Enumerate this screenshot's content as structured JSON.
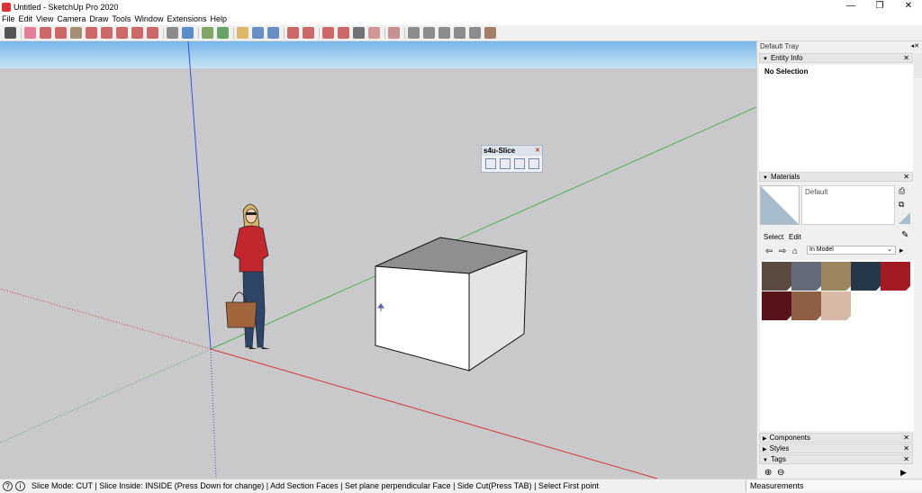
{
  "window": {
    "title": "Untitled - SketchUp Pro 2020",
    "controls": [
      "—",
      "❐",
      "✕"
    ]
  },
  "menu": [
    "File",
    "Edit",
    "View",
    "Camera",
    "Draw",
    "Tools",
    "Window",
    "Extensions",
    "Help"
  ],
  "toolbar": {
    "tools": [
      {
        "icon": "select-icon",
        "color": "#222222"
      },
      {
        "icon": "eraser-icon",
        "color": "#e05a7a"
      },
      {
        "icon": "line-icon",
        "color": "#c23b3b"
      },
      {
        "icon": "arc-icon",
        "color": "#c23b3b"
      },
      {
        "icon": "shape-icon",
        "color": "#8d6d4a"
      },
      {
        "icon": "push-pull-icon",
        "color": "#c23b3b"
      },
      {
        "icon": "offset-icon",
        "color": "#c23b3b"
      },
      {
        "icon": "move-icon",
        "color": "#c23b3b"
      },
      {
        "icon": "rotate-icon",
        "color": "#c23b3b"
      },
      {
        "icon": "scale-icon",
        "color": "#c23b3b"
      },
      {
        "icon": "tape-measure-icon",
        "color": "#6a6a6a"
      },
      {
        "icon": "text-icon",
        "color": "#2a6ebb"
      },
      {
        "icon": "paint-bucket-icon",
        "color": "#5a8c3a"
      },
      {
        "icon": "orbit-icon",
        "color": "#3a8a3a"
      },
      {
        "icon": "pan-icon",
        "color": "#d6a33c"
      },
      {
        "icon": "zoom-icon",
        "color": "#3a6fb5"
      },
      {
        "icon": "zoom-extents-icon",
        "color": "#3a6fb5"
      },
      {
        "icon": "warehouse-icon",
        "color": "#c23b3b"
      },
      {
        "icon": "extension-warehouse-icon",
        "color": "#c23b3b"
      },
      {
        "icon": "layout-icon",
        "color": "#c23b3b"
      },
      {
        "icon": "ruby-icon",
        "color": "#c23b3b"
      },
      {
        "icon": "account-icon",
        "color": "#4a4a4a"
      },
      {
        "icon": "section-plane-icon",
        "color": "#c77a7a"
      },
      {
        "icon": "style-icon-1",
        "color": "#b57070"
      },
      {
        "icon": "style-icon-2",
        "color": "#6b6b6b"
      },
      {
        "icon": "style-icon-3",
        "color": "#6b6b6b"
      },
      {
        "icon": "style-icon-4",
        "color": "#6b6b6b"
      },
      {
        "icon": "style-icon-5",
        "color": "#6b6b6b"
      },
      {
        "icon": "style-icon-6",
        "color": "#6b6b6b"
      },
      {
        "icon": "style-icon-7",
        "color": "#8a5a3a"
      }
    ]
  },
  "slice_toolbar": {
    "title": "s4u-Slice",
    "buttons": [
      "slice-mode-icon",
      "slice-inside-icon",
      "slice-section-icon",
      "slice-cut-icon"
    ]
  },
  "tray": {
    "title": "Default Tray",
    "entity_info": {
      "header": "Entity Info",
      "selection": "No Selection"
    },
    "materials": {
      "header": "Materials",
      "material_name": "Default",
      "tabs": [
        "Select",
        "Edit"
      ],
      "collection": "In Model",
      "swatches": [
        "#5b4a3f",
        "#656b78",
        "#9b8660",
        "#27374a",
        "#a31a22",
        "#5a1318",
        "#8f5f44",
        "#d8b9a8"
      ]
    },
    "collapsed_panels": [
      "Components",
      "Styles",
      "Tags"
    ]
  },
  "status": {
    "text": "Slice Mode: CUT | Slice Inside: INSIDE (Press Down for change) | Add Section Faces | Set plane perpendicular Face | Side Cut(Press TAB) | Select First point",
    "measurements_label": "Measurements",
    "help_icon": "?",
    "info_icon": "i"
  },
  "colors": {
    "sky": "#8fc6ec",
    "ground": "#c9c9cc",
    "axis_red": "#d43b3b",
    "axis_green": "#4caf50",
    "axis_blue": "#3a4fd1",
    "cube_top": "#8f8f8f",
    "cube_front": "#ffffff",
    "cube_side": "#e4e4e4"
  }
}
